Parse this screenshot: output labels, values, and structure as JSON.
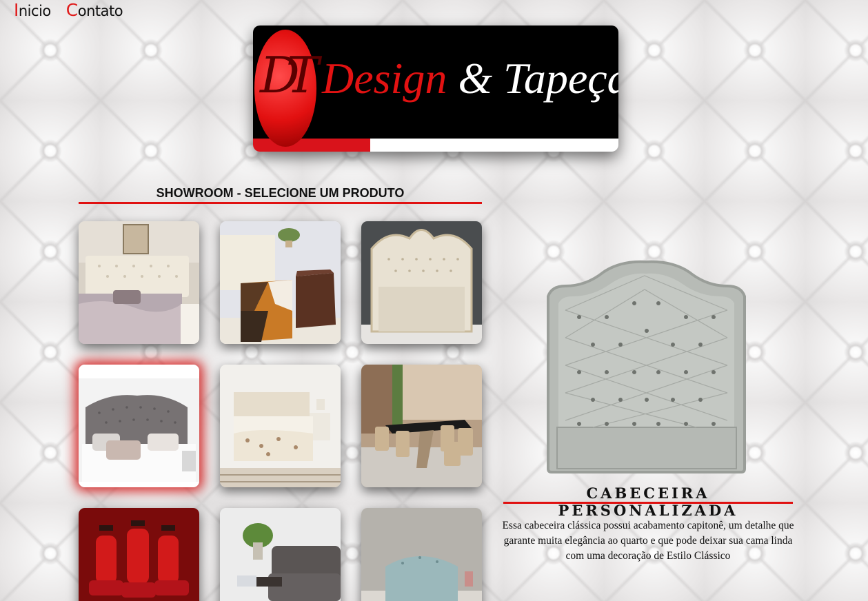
{
  "nav": {
    "home": {
      "cap": "I",
      "rest": "nicio"
    },
    "contact": {
      "cap": "C",
      "rest": "ontato"
    }
  },
  "logo": {
    "monogram": "DT",
    "word1": "Design",
    "amp": " & ",
    "word2": "Tapeçaria"
  },
  "showroom": {
    "title": "SHOWROOM - SELECIONE UM PRODUTO",
    "products": [
      {
        "name": "cabeceira-capitone-bege",
        "icon": "headboard-photo"
      },
      {
        "name": "puffs-decorativos",
        "icon": "ottoman-photo"
      },
      {
        "name": "cabeceira-provencal",
        "icon": "headboard-photo"
      },
      {
        "name": "cabeceira-personalizada",
        "icon": "headboard-photo",
        "selected": true
      },
      {
        "name": "cama-box-bege",
        "icon": "bed-photo"
      },
      {
        "name": "mesa-de-jantar-cadeiras",
        "icon": "dining-photo"
      },
      {
        "name": "cadeiras-vermelhas",
        "icon": "chairs-photo"
      },
      {
        "name": "sofa-cinza",
        "icon": "sofa-photo"
      },
      {
        "name": "puff-azul",
        "icon": "ottoman-photo"
      }
    ]
  },
  "detail": {
    "title": "CABECEIRA PERSONALIZADA",
    "description": "Essa cabeceira clássica possui acabamento capitonê, um detalhe que garante muita elegância ao quarto e que pode deixar sua cama linda com uma decoração de Estilo Clássico"
  },
  "colors": {
    "accent": "#e01111",
    "text": "#111111"
  }
}
